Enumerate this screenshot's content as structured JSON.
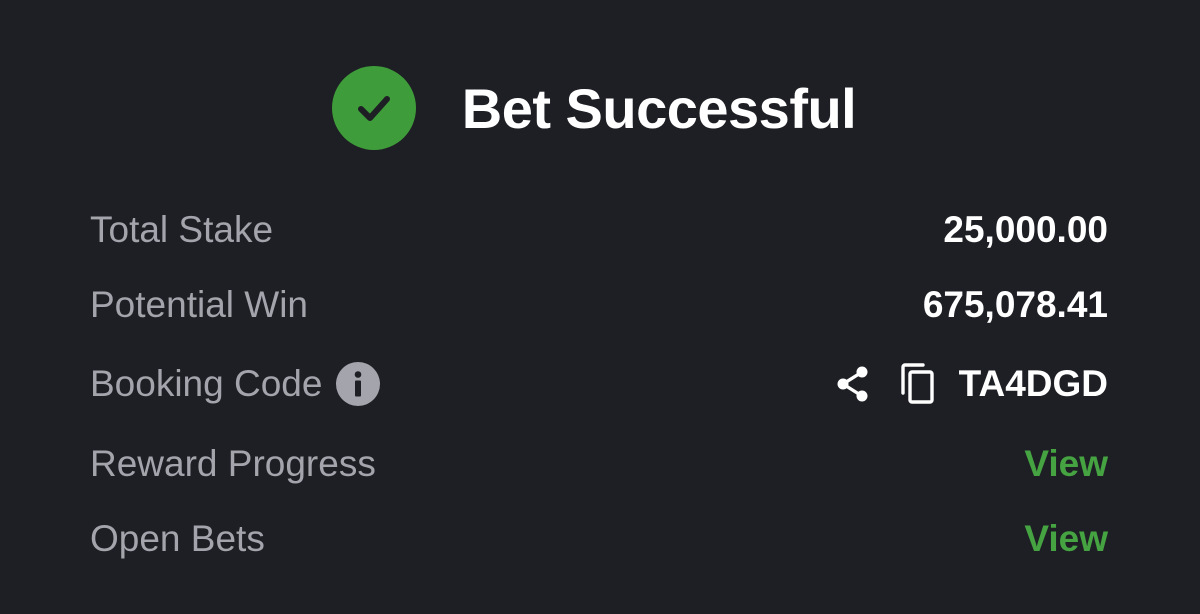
{
  "header": {
    "title": "Bet Successful",
    "success_color": "#3f9c3a",
    "icon": "check-circle-icon"
  },
  "summary": {
    "total_stake": {
      "label": "Total Stake",
      "value": "25,000.00"
    },
    "potential_win": {
      "label": "Potential Win",
      "value": "675,078.41"
    },
    "booking_code": {
      "label": "Booking Code",
      "value": "TA4DGD",
      "icons": [
        "info-icon",
        "share-icon",
        "copy-icon"
      ]
    },
    "reward_progress": {
      "label": "Reward Progress",
      "link": "View"
    },
    "open_bets": {
      "label": "Open Bets",
      "link": "View"
    }
  },
  "colors": {
    "background": "#1e1f24",
    "label": "#a4a4ac",
    "value": "#ffffff",
    "link": "#45a342"
  }
}
